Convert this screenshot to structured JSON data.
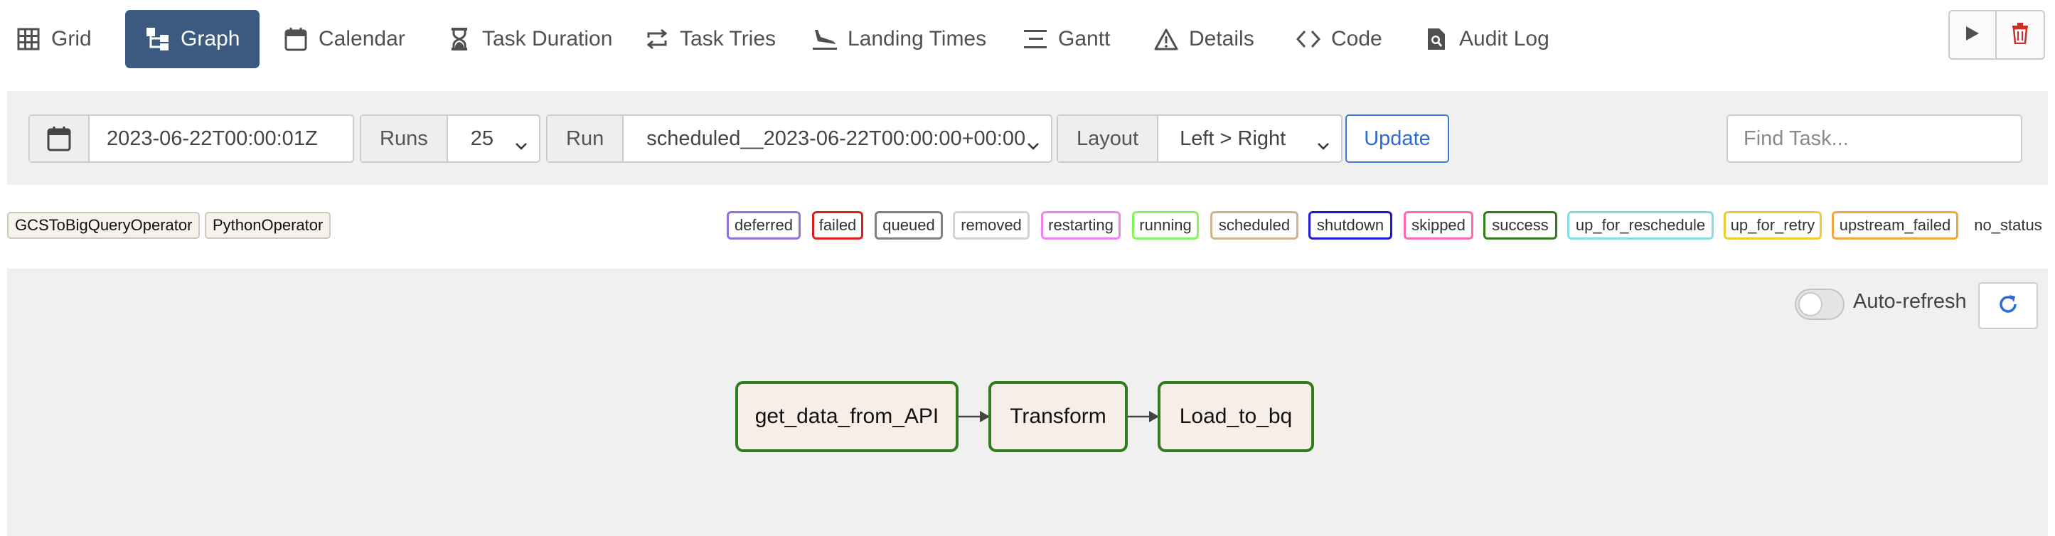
{
  "tabs": [
    {
      "label": "Grid",
      "icon": "grid-icon",
      "active": false
    },
    {
      "label": "Graph",
      "icon": "graph-icon",
      "active": true
    },
    {
      "label": "Calendar",
      "icon": "calendar-icon",
      "active": false
    },
    {
      "label": "Task Duration",
      "icon": "hourglass-icon",
      "active": false
    },
    {
      "label": "Task Tries",
      "icon": "retry-icon",
      "active": false
    },
    {
      "label": "Landing Times",
      "icon": "plane-landing-icon",
      "active": false
    },
    {
      "label": "Gantt",
      "icon": "gantt-icon",
      "active": false
    },
    {
      "label": "Details",
      "icon": "warning-triangle-icon",
      "active": false
    },
    {
      "label": "Code",
      "icon": "code-icon",
      "active": false
    },
    {
      "label": "Audit Log",
      "icon": "file-search-icon",
      "active": false
    }
  ],
  "actions": {
    "play_icon": "play-icon",
    "delete_icon": "trash-icon",
    "delete_color": "#c9302c"
  },
  "toolbar": {
    "base_date": "2023-06-22T00:00:01Z",
    "runs_label": "Runs",
    "runs_value": "25",
    "run_label": "Run",
    "run_value": "scheduled__2023-06-22T00:00:00+00:00",
    "layout_label": "Layout",
    "layout_value": "Left > Right",
    "update_label": "Update",
    "find_placeholder": "Find Task..."
  },
  "operators": [
    "GCSToBigQueryOperator",
    "PythonOperator"
  ],
  "states": [
    {
      "label": "deferred",
      "color": "#9370db"
    },
    {
      "label": "failed",
      "color": "#dc1f1f"
    },
    {
      "label": "queued",
      "color": "#808080"
    },
    {
      "label": "removed",
      "color": "#d3d3d3"
    },
    {
      "label": "restarting",
      "color": "#ee82ee"
    },
    {
      "label": "running",
      "color": "#84f55d"
    },
    {
      "label": "scheduled",
      "color": "#d2b48c"
    },
    {
      "label": "shutdown",
      "color": "#1e19d4"
    },
    {
      "label": "skipped",
      "color": "#ff69b4"
    },
    {
      "label": "success",
      "color": "#2f7d1f"
    },
    {
      "label": "up_for_reschedule",
      "color": "#84dfe1"
    },
    {
      "label": "up_for_retry",
      "color": "#f1ca3a"
    },
    {
      "label": "upstream_failed",
      "color": "#f2a93b"
    },
    {
      "label": "no_status",
      "color": ""
    }
  ],
  "graph": {
    "auto_refresh_label": "Auto-refresh",
    "auto_refresh_on": false,
    "refresh_icon": "refresh-icon",
    "nodes": [
      {
        "label": "get_data_from_API",
        "state": "success"
      },
      {
        "label": "Transform",
        "state": "success"
      },
      {
        "label": "Load_to_bq",
        "state": "success"
      }
    ],
    "edges": [
      [
        "get_data_from_API",
        "Transform"
      ],
      [
        "Transform",
        "Load_to_bq"
      ]
    ]
  }
}
